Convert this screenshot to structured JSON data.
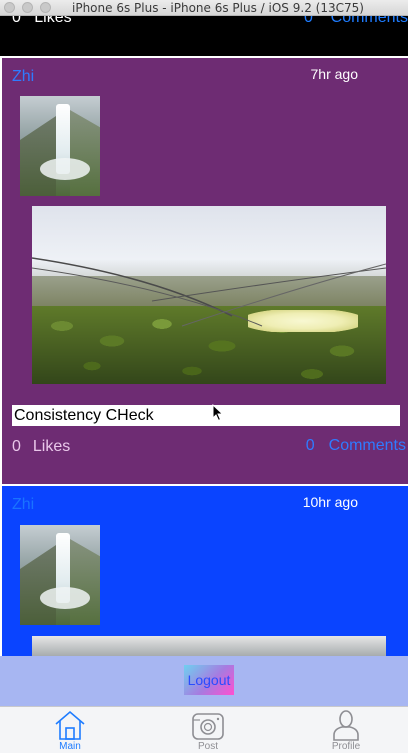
{
  "window": {
    "title": "iPhone 6s Plus - iPhone 6s Plus / iOS 9.2 (13C75)"
  },
  "previous_post": {
    "likes_count": "0",
    "likes_label": "Likes",
    "comments_count": "0",
    "comments_label": "Comments"
  },
  "posts": [
    {
      "username": "Zhi",
      "time": "7hr ago",
      "caption": "Consistency CHeck",
      "likes_count": "0",
      "likes_label": "Likes",
      "comments_count": "0",
      "comments_label": "Comments",
      "background": "#6e2c73"
    },
    {
      "username": "Zhi",
      "time": "10hr ago",
      "background": "#0a44ff"
    }
  ],
  "logout": {
    "label": "Logout"
  },
  "tabs": [
    {
      "label": "Main",
      "icon": "home-icon",
      "selected": true
    },
    {
      "label": "Post",
      "icon": "camera-icon",
      "selected": false
    },
    {
      "label": "Profile",
      "icon": "person-icon",
      "selected": false
    }
  ],
  "colors": {
    "accent": "#1e7cff",
    "logout_bar": "#a7b6f2"
  }
}
